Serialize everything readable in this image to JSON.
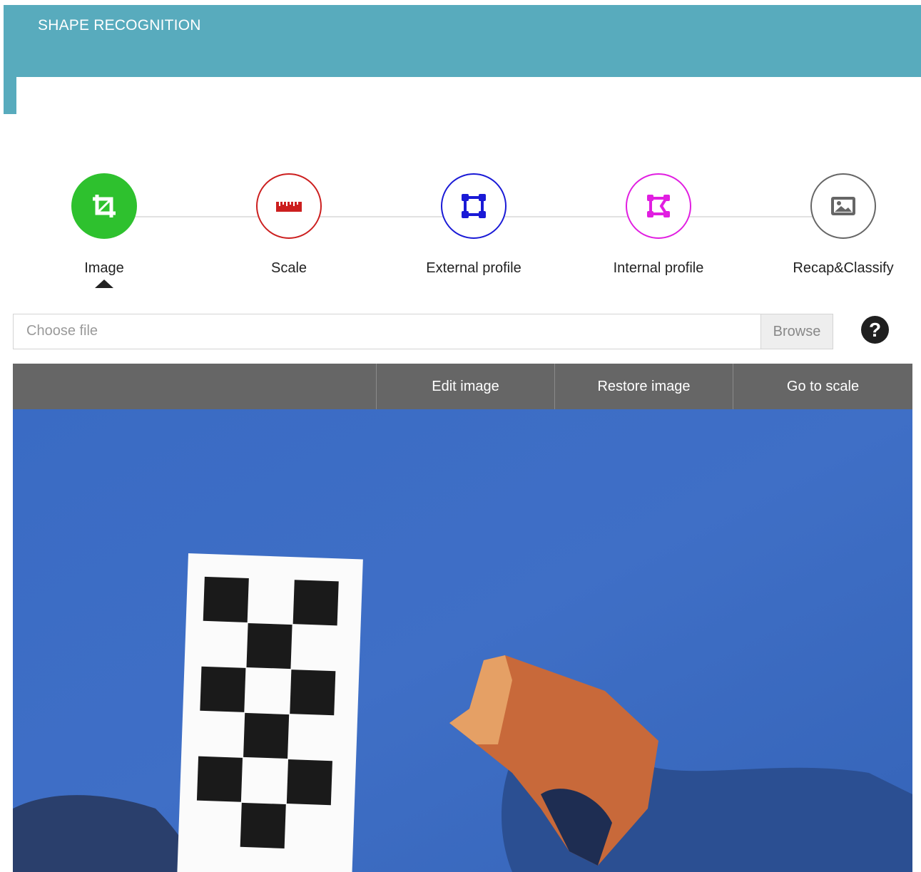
{
  "header": {
    "title": "SHAPE RECOGNITION"
  },
  "colors": {
    "header": "#58abbd",
    "toolbar": "#666666",
    "step_image": "#2ec12e",
    "step_scale": "#cc1f1f",
    "step_external": "#1a1ad6",
    "step_internal": "#e11ee1",
    "step_recap": "#666666"
  },
  "stepper": {
    "steps": [
      {
        "label": "Image",
        "icon": "crop-icon",
        "active": true
      },
      {
        "label": "Scale",
        "icon": "ruler-icon",
        "active": false
      },
      {
        "label": "External profile",
        "icon": "square-nodes-icon",
        "active": false
      },
      {
        "label": "Internal profile",
        "icon": "polygon-nodes-icon",
        "active": false
      },
      {
        "label": "Recap&Classify",
        "icon": "image-icon",
        "active": false
      }
    ]
  },
  "file_input": {
    "placeholder": "Choose file",
    "browse_label": "Browse",
    "help_icon": "question-circle-icon"
  },
  "toolbar": {
    "edit_label": "Edit image",
    "restore_label": "Restore image",
    "goto_label": "Go to scale"
  },
  "image": {
    "description_icon": "photo-canvas"
  }
}
